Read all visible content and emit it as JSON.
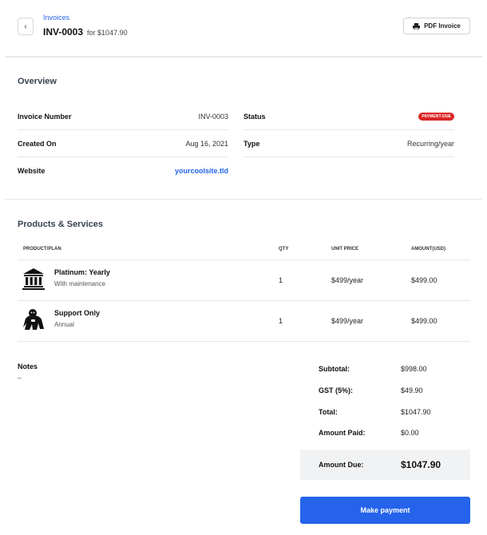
{
  "header": {
    "breadcrumb": "Invoices",
    "invoice_id": "INV-0003",
    "for_text": "for $1047.90",
    "back_icon": "chevron-left-icon",
    "pdf_button": {
      "label": "PDF Invoice",
      "icon": "printer-icon"
    }
  },
  "overview": {
    "title": "Overview",
    "left": [
      {
        "label": "Invoice Number",
        "value": "INV-0003"
      },
      {
        "label": "Created On",
        "value": "Aug 16, 2021"
      },
      {
        "label": "Website",
        "value": "yourcoolsite.tld"
      }
    ],
    "right": [
      {
        "label": "Status",
        "value": "PAYMENT-DUE"
      },
      {
        "label": "Type",
        "value": "Recurring/year"
      }
    ],
    "colors": {
      "link": "#2563eb",
      "badge": "#dc2626"
    }
  },
  "products": {
    "title": "Products & Services",
    "columns": [
      "PRODUCT/PLAN",
      "QTY",
      "UNIT PRICE",
      "AMOUNT(USD)"
    ],
    "rows": [
      {
        "icon": "bank-building-icon",
        "name": "Platinum: Yearly",
        "sub": "With maintenance",
        "qty": "1",
        "unit_price": "$499/year",
        "amount": "$499.00"
      },
      {
        "icon": "gorilla-icon",
        "name": "Support Only",
        "sub": "Annual",
        "qty": "1",
        "unit_price": "$499/year",
        "amount": "$499.00"
      }
    ]
  },
  "notes": {
    "label": "Notes",
    "value": "–"
  },
  "totals": {
    "items": [
      {
        "label": "Subtotal:",
        "value": "$998.00"
      },
      {
        "label": "GST (5%):",
        "value": "$49.90"
      },
      {
        "label": "Total:",
        "value": "$1047.90"
      },
      {
        "label": "Amount Paid:",
        "value": "$0.00"
      }
    ],
    "amount_due_label": "Amount Due:",
    "amount_due_value": "$1047.90"
  },
  "pay_button": {
    "label": "Make payment",
    "color": "#2563eb"
  }
}
